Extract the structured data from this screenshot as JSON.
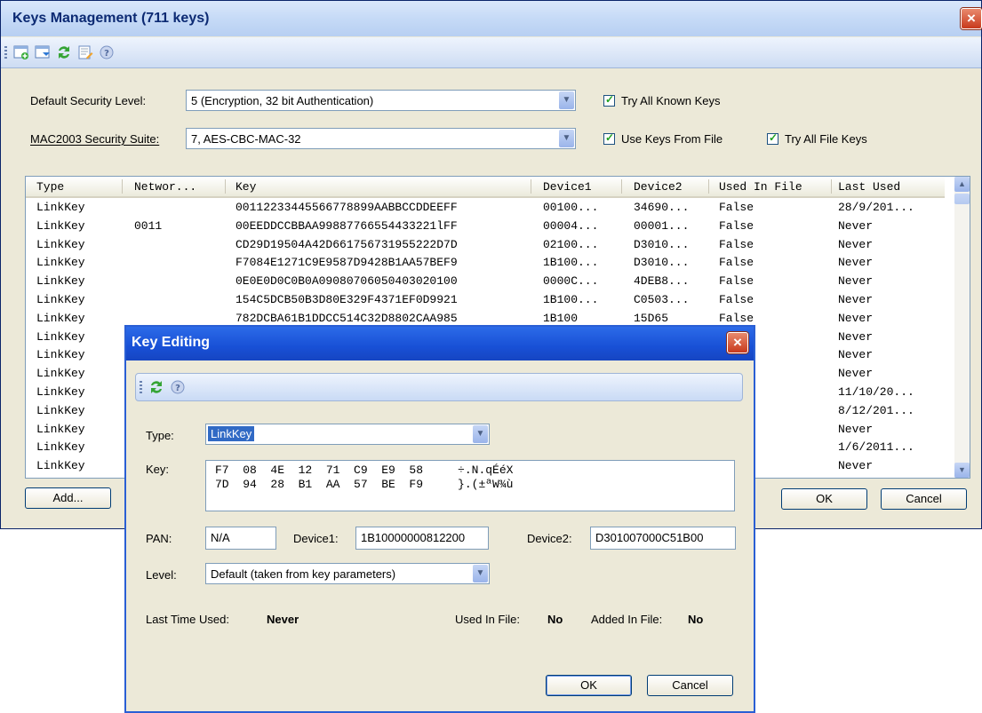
{
  "window": {
    "title": "Keys Management (711 keys)"
  },
  "toolbar": {
    "icons": [
      "add-key-icon",
      "import-key-icon",
      "refresh-icon",
      "edit-icon",
      "help-icon"
    ]
  },
  "settings": {
    "security_level_label": "Default Security Level:",
    "security_level_value": "5 (Encryption, 32 bit Authentication)",
    "suite_label": "MAC2003 Security Suite:",
    "suite_value": "7, AES-CBC-MAC-32",
    "try_all_known_label": "Try All Known Keys",
    "use_keys_from_file_label": "Use Keys From File",
    "try_all_file_keys_label": "Try All File Keys"
  },
  "table": {
    "headers": [
      "Type",
      "Networ...",
      "Key",
      "Device1",
      "Device2",
      "Used In File",
      "Last Used"
    ],
    "rows": [
      [
        "LinkKey",
        "",
        "00112233445566778899AABBCCDDEEFF",
        "00100...",
        "34690...",
        "False",
        "28/9/201..."
      ],
      [
        "LinkKey",
        "0011",
        "00EEDDCCBBAA99887766554433221lFF",
        "00004...",
        "00001...",
        "False",
        "Never"
      ],
      [
        "LinkKey",
        "",
        "CD29D19504A42D661756731955222D7D",
        "02100...",
        "D3010...",
        "False",
        "Never"
      ],
      [
        "LinkKey",
        "",
        "F7084E1271C9E9587D9428B1AA57BEF9",
        "1B100...",
        "D3010...",
        "False",
        "Never"
      ],
      [
        "LinkKey",
        "",
        "0E0E0D0C0B0A09080706050403020100",
        "0000C...",
        "4DEB8...",
        "False",
        "Never"
      ],
      [
        "LinkKey",
        "",
        "154C5DCB50B3D80E329F4371EF0D9921",
        "1B100...",
        "C0503...",
        "False",
        "Never"
      ],
      [
        "LinkKey",
        "",
        "782DCBA61B1DDCC514C32D8802CAA985",
        "1B100",
        "15D65",
        "False",
        "Never"
      ],
      [
        "LinkKey",
        "",
        "",
        "",
        "",
        "",
        "Never"
      ],
      [
        "LinkKey",
        "",
        "",
        "",
        "",
        "",
        "Never"
      ],
      [
        "LinkKey",
        "",
        "",
        "",
        "",
        "",
        "Never"
      ],
      [
        "LinkKey",
        "",
        "",
        "",
        "",
        "",
        "11/10/20..."
      ],
      [
        "LinkKey",
        "",
        "",
        "",
        "",
        "",
        "8/12/201..."
      ],
      [
        "LinkKey",
        "",
        "",
        "",
        "",
        "",
        "Never"
      ],
      [
        "LinkKey",
        "",
        "",
        "",
        "",
        "",
        "1/6/2011..."
      ],
      [
        "LinkKey",
        "",
        "",
        "",
        "",
        "",
        "Never"
      ]
    ]
  },
  "buttons": {
    "add": "Add...",
    "ok": "OK",
    "cancel": "Cancel"
  },
  "dialog": {
    "title": "Key Editing",
    "type_label": "Type:",
    "type_value": "LinkKey",
    "key_label": "Key:",
    "key_line1": "F7  08  4E  12  71  C9  E9  58     ÷.N.qÉéX",
    "key_line2": "7D  94  28  B1  AA  57  BE  F9     }.(±ªW¾ù",
    "pan_label": "PAN:",
    "pan_value": "N/A",
    "device1_label": "Device1:",
    "device1_value": "1B10000000812200",
    "device2_label": "Device2:",
    "device2_value": "D301007000C51B00",
    "level_label": "Level:",
    "level_value": "Default (taken from key parameters)",
    "last_used_label": "Last Time Used:",
    "last_used_value": "Never",
    "used_in_file_label": "Used In File:",
    "used_in_file_value": "No",
    "added_in_file_label": "Added In File:",
    "added_in_file_value": "No",
    "ok": "OK",
    "cancel": "Cancel"
  }
}
